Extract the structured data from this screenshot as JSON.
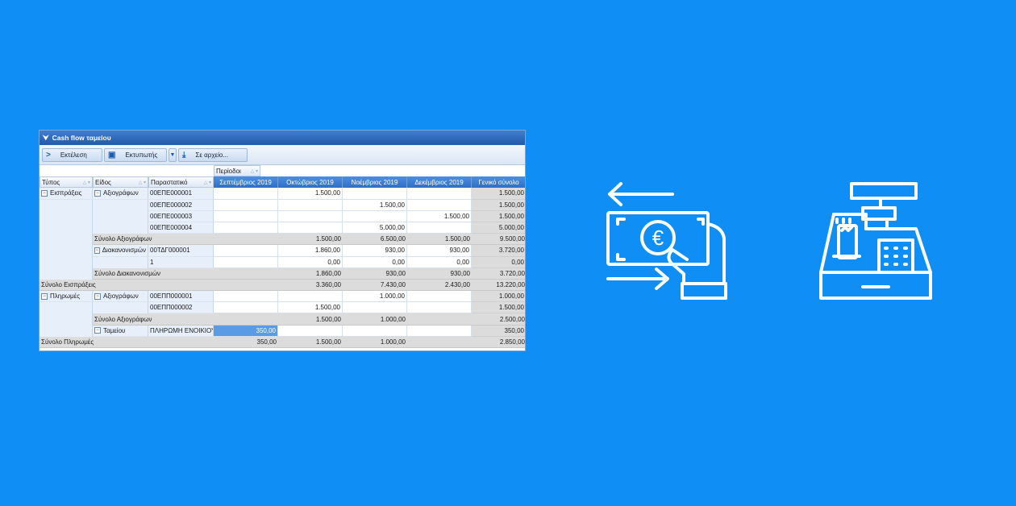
{
  "window": {
    "title": "Cash flow ταμείου"
  },
  "toolbar": {
    "run_label": "Εκτέλεση",
    "print_label": "Εκτυπωτής",
    "export_label": "Σε αρχείο..."
  },
  "grid": {
    "period_header": "Περίοδοι",
    "row_headers": [
      "Τύπος",
      "Είδος",
      "Παραστατικό"
    ],
    "columns": [
      "Σεπτέμβριος 2019",
      "Οκτώβριος 2019",
      "Νοέμβριος 2019",
      "Δεκέμβριος 2019",
      "Γενικό σύνολο"
    ],
    "rows": [
      {
        "type": "Εισπράξεις",
        "kind": "Αξιογράφων",
        "doc": "00ΕΠΕ000001",
        "vals": [
          "",
          "1.500,00",
          "",
          "",
          "1.500,00"
        ]
      },
      {
        "type": "",
        "kind": "",
        "doc": "00ΕΠΕ000002",
        "vals": [
          "",
          "",
          "1.500,00",
          "",
          "1.500,00"
        ]
      },
      {
        "type": "",
        "kind": "",
        "doc": "00ΕΠΕ000003",
        "vals": [
          "",
          "",
          "",
          "1.500,00",
          "1.500,00"
        ]
      },
      {
        "type": "",
        "kind": "",
        "doc": "00ΕΠΕ000004",
        "vals": [
          "",
          "",
          "5.000,00",
          "",
          "5.000,00"
        ]
      },
      {
        "subtotal": "Σύνολο Αξιογράφων",
        "vals": [
          "",
          "1.500,00",
          "6.500,00",
          "1.500,00",
          "9.500,00"
        ]
      },
      {
        "type": "",
        "kind": "Διακανονισμών",
        "doc": "00ΤΔΓ000001",
        "vals": [
          "",
          "1.860,00",
          "930,00",
          "930,00",
          "3.720,00"
        ]
      },
      {
        "type": "",
        "kind": "",
        "doc": "1",
        "vals": [
          "",
          "0,00",
          "0,00",
          "0,00",
          "0,00"
        ]
      },
      {
        "subtotal": "Σύνολο Διακανονισμών",
        "vals": [
          "",
          "1.860,00",
          "930,00",
          "930,00",
          "3.720,00"
        ]
      },
      {
        "total": "Σύνολο Εισπράξεις",
        "vals": [
          "",
          "3.360,00",
          "7.430,00",
          "2.430,00",
          "13.220,00"
        ]
      },
      {
        "type": "Πληρωμές",
        "kind": "Αξιογράφων",
        "doc": "00ΕΠΠ000001",
        "vals": [
          "",
          "",
          "1.000,00",
          "",
          "1.000,00"
        ]
      },
      {
        "type": "",
        "kind": "",
        "doc": "00ΕΠΠ000002",
        "vals": [
          "",
          "1.500,00",
          "",
          "",
          "1.500,00"
        ]
      },
      {
        "subtotal": "Σύνολο Αξιογράφων",
        "vals": [
          "",
          "1.500,00",
          "1.000,00",
          "",
          "2.500,00"
        ]
      },
      {
        "type": "",
        "kind": "Ταμείου",
        "doc": "ΠΛΗΡΩΜΗ ΕΝΟΙΚΙΟΥ",
        "vals": [
          "350,00",
          "",
          "",
          "",
          "350,00"
        ]
      },
      {
        "total": "Σύνολο Πληρωμές",
        "vals": [
          "350,00",
          "1.500,00",
          "1.000,00",
          "",
          "2.850,00"
        ]
      }
    ]
  },
  "icons": {
    "money_transfer": "money-transfer-euro-icon",
    "cash_register": "cash-register-icon",
    "euro_symbol": "€"
  },
  "colors": {
    "background": "#0f8ff5",
    "header_blue": "#2f6fc6"
  }
}
